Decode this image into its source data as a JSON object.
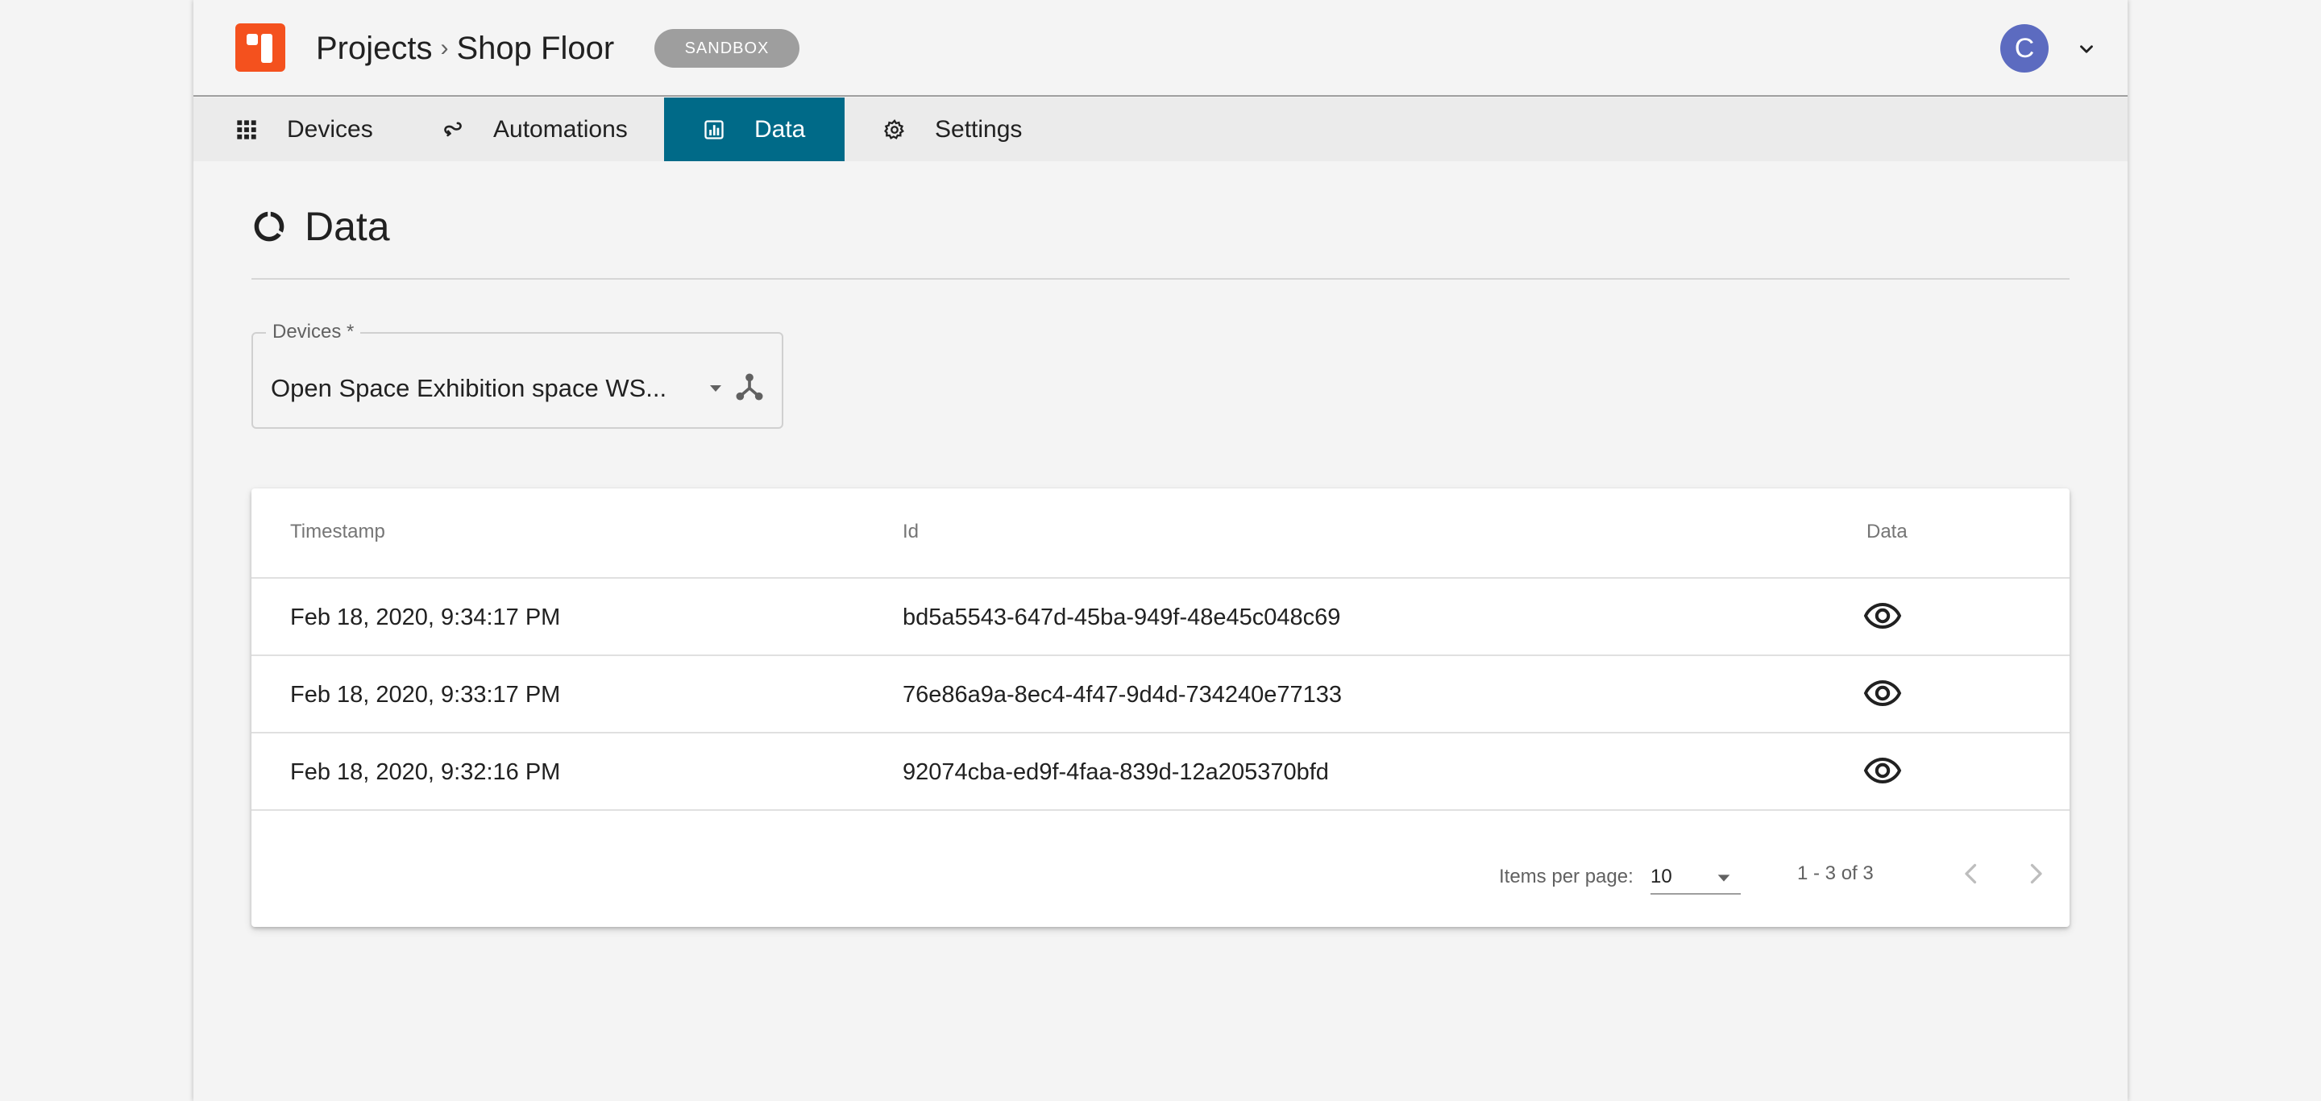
{
  "header": {
    "breadcrumb": [
      "Projects",
      "Shop Floor"
    ],
    "breadcrumb_separator": "›",
    "env_badge": "SANDBOX",
    "avatar_initial": "C"
  },
  "nav": {
    "tabs": [
      {
        "label": "Devices",
        "icon": "grid-icon"
      },
      {
        "label": "Automations",
        "icon": "automation-icon"
      },
      {
        "label": "Data",
        "icon": "bar-chart-icon",
        "active": true
      },
      {
        "label": "Settings",
        "icon": "gear-icon"
      }
    ]
  },
  "main": {
    "title": "Data",
    "devices_field": {
      "label": "Devices *",
      "value": "Open Space Exhibition space WS..."
    },
    "table": {
      "headers": [
        "Timestamp",
        "Id",
        "Data"
      ],
      "rows": [
        {
          "timestamp": "Feb 18, 2020, 9:34:17 PM",
          "id": "bd5a5543-647d-45ba-949f-48e45c048c69"
        },
        {
          "timestamp": "Feb 18, 2020, 9:33:17 PM",
          "id": "76e86a9a-8ec4-4f47-9d4d-734240e77133"
        },
        {
          "timestamp": "Feb 18, 2020, 9:32:16 PM",
          "id": "92074cba-ed9f-4faa-839d-12a205370bfd"
        }
      ]
    },
    "paginator": {
      "items_per_page_label": "Items per page:",
      "items_per_page": "10",
      "range": "1 - 3 of 3"
    }
  },
  "colors": {
    "accent": "#006a88",
    "logo": "#f4511e",
    "avatar": "#5c6bc0",
    "badge": "#9e9e9e"
  }
}
